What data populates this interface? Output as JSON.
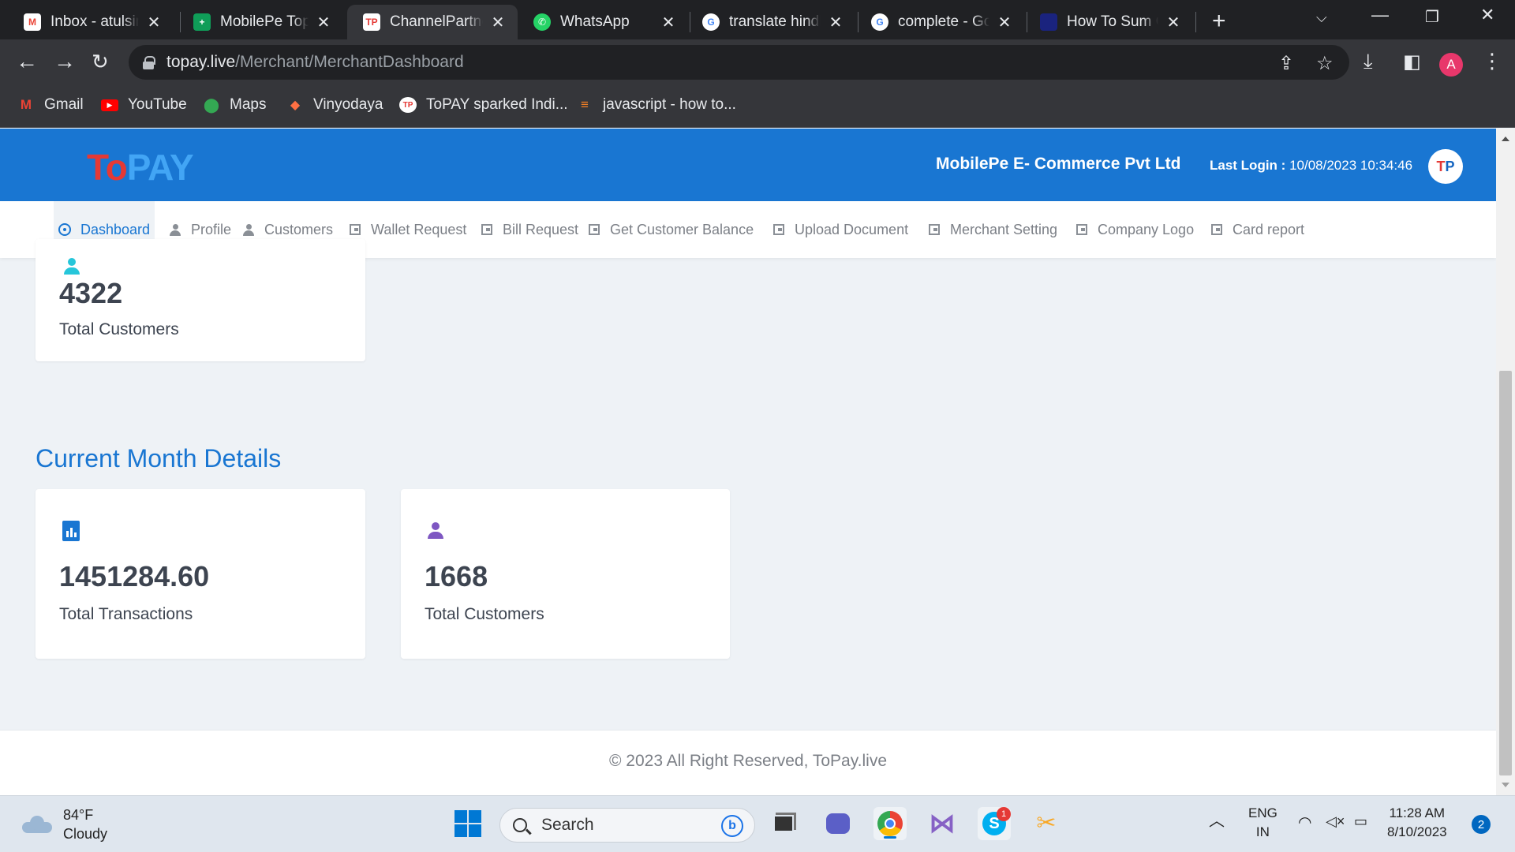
{
  "browser": {
    "tabs": [
      {
        "title": "Inbox - atulsingh",
        "favicon": "gmail-icon",
        "color": "#ea4335"
      },
      {
        "title": "MobilePe Topay",
        "favicon": "sheets-icon",
        "color": "#0f9d58"
      },
      {
        "title": "ChannelPartner",
        "favicon": "topay-icon",
        "color": "#e53935"
      },
      {
        "title": "WhatsApp",
        "favicon": "whatsapp-icon",
        "color": "#25d366"
      },
      {
        "title": "translate hindi",
        "favicon": "google-icon",
        "color": "#4285f4"
      },
      {
        "title": "complete - Google",
        "favicon": "google-icon",
        "color": "#4285f4"
      },
      {
        "title": "How To Sum C",
        "favicon": "generic-icon",
        "color": "#1a237e"
      }
    ],
    "url_host": "topay.live",
    "url_path": "/Merchant/MerchantDashboard",
    "profile_initial": "A",
    "bookmarks": [
      {
        "label": "Gmail",
        "icon": "gmail-icon"
      },
      {
        "label": "YouTube",
        "icon": "youtube-icon"
      },
      {
        "label": "Maps",
        "icon": "maps-icon"
      },
      {
        "label": "Vinyodaya",
        "icon": "vinyodaya-icon"
      },
      {
        "label": "ToPAY sparked Indi...",
        "icon": "topay-icon"
      },
      {
        "label": "javascript - how to...",
        "icon": "stackoverflow-icon"
      }
    ]
  },
  "header": {
    "logo_to": "To",
    "logo_pay": "PAY",
    "company": "MobilePe E- Commerce Pvt Ltd",
    "last_login_label": "Last Login :",
    "last_login_value": "10/08/2023 10:34:46",
    "avatar_t": "T",
    "avatar_p": "P"
  },
  "menu": [
    {
      "label": "Dashboard",
      "icon": "dashboard-icon",
      "active": true
    },
    {
      "label": "Profile",
      "icon": "user-icon"
    },
    {
      "label": "Customers",
      "icon": "user-icon"
    },
    {
      "label": "Wallet Request",
      "icon": "wallet-icon"
    },
    {
      "label": "Bill Request",
      "icon": "wallet-icon"
    },
    {
      "label": "Get Customer Balance",
      "icon": "wallet-icon"
    },
    {
      "label": "Upload Document",
      "icon": "wallet-icon"
    },
    {
      "label": "Merchant Setting",
      "icon": "wallet-icon"
    },
    {
      "label": "Company Logo",
      "icon": "wallet-icon"
    },
    {
      "label": "Card report",
      "icon": "wallet-icon"
    }
  ],
  "overall": {
    "customers_value": "4322",
    "customers_label": "Total Customers"
  },
  "current_month": {
    "title": "Current Month Details",
    "transactions_value": "1451284.60",
    "transactions_label": "Total Transactions",
    "customers_value": "1668",
    "customers_label": "Total Customers"
  },
  "footer": {
    "text": "© 2023 All Right Reserved, ToPay.live"
  },
  "taskbar": {
    "temperature": "84°F",
    "condition": "Cloudy",
    "search_placeholder": "Search",
    "language": "ENG",
    "region": "IN",
    "time": "11:28 AM",
    "date": "8/10/2023",
    "notification_count": "2",
    "skype_badge": "1"
  },
  "colors": {
    "brand_blue": "#1976d2",
    "brand_red": "#e53935",
    "teal_icon": "#26c6da",
    "purple_icon": "#7e57c2"
  }
}
